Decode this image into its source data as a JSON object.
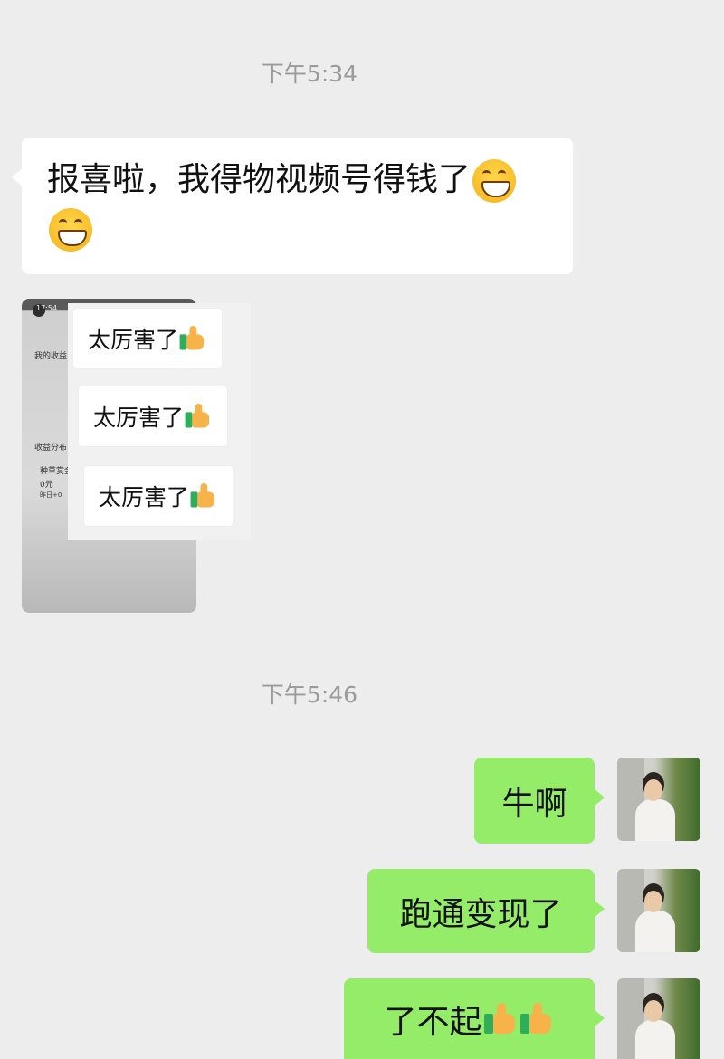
{
  "timestamps": [
    "下午5:34",
    "下午5:46"
  ],
  "incoming": {
    "text": "报喜啦，我得物视频号得钱了",
    "emoji": "grinning-face-icon"
  },
  "image_message": {
    "status_time": "17:54",
    "labels": [
      "我的收益",
      "收益分布",
      "种草赏金",
      "0元",
      "昨日+0"
    ]
  },
  "stickers": [
    "太厉害了",
    "太厉害了",
    "太厉害了"
  ],
  "outgoing": [
    {
      "text": "牛啊"
    },
    {
      "text": "跑通变现了"
    },
    {
      "text": "了不起"
    }
  ],
  "colors": {
    "background": "#ededed",
    "incoming_bubble": "#ffffff",
    "outgoing_bubble": "#95ec69",
    "timestamp": "#9a9a9a"
  }
}
